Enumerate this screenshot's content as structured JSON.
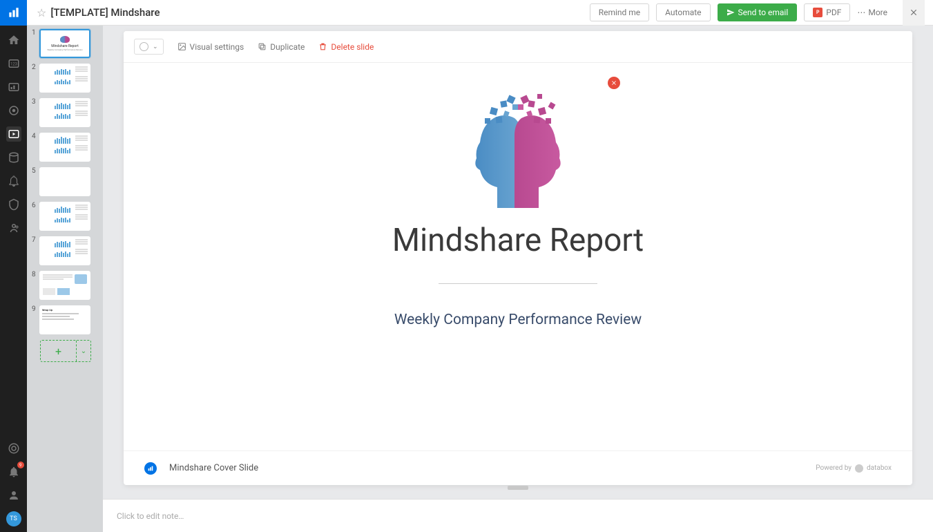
{
  "header": {
    "title": "[TEMPLATE] Mindshare",
    "remind_me": "Remind me",
    "automate": "Automate",
    "send_email": "Send to email",
    "pdf": "PDF",
    "more": "More"
  },
  "rail": {
    "avatar_initials": "TS"
  },
  "thumbs": {
    "count": 9,
    "cover_title": "Mindshare Report",
    "cover_sub": "Weekly Company Performance Review"
  },
  "toolbar": {
    "visual_settings": "Visual settings",
    "duplicate": "Duplicate",
    "delete_slide": "Delete slide"
  },
  "slide": {
    "title": "Mindshare Report",
    "subtitle": "Weekly Company Performance Review",
    "footer_title": "Mindshare Cover Slide",
    "powered_by": "Powered by",
    "powered_brand": "databox"
  },
  "notes": {
    "placeholder": "Click to edit note…"
  }
}
